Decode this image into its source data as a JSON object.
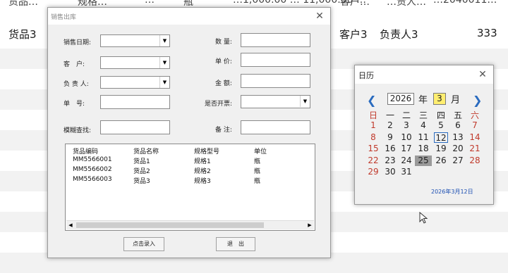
{
  "sheet": {
    "top_row_fragments": [
      "货品…",
      "规格…",
      "…",
      "瓶",
      "…1,000.00 … 11,000.00 …",
      "客户…",
      "…责人…",
      "…2040011…"
    ],
    "row": {
      "product": "货品3",
      "customer": "客户3",
      "owner": "负责人3",
      "number": "333"
    }
  },
  "sales_dialog": {
    "title": "销售出库",
    "close_glyph": "✕",
    "labels": {
      "sale_date": "销售日期:",
      "customer": "客　户:",
      "owner": "负 责 人:",
      "doc_no": "单　号:",
      "quantity": "数 量:",
      "unit_price": "单 价:",
      "amount": "金 额:",
      "invoiced": "是否开票:",
      "fuzzy_search": "模糊查找:",
      "remark": "备 注:"
    },
    "values": {
      "sale_date": "",
      "customer": "",
      "owner": "",
      "doc_no": "",
      "quantity": "",
      "unit_price": "",
      "amount": "",
      "invoiced": "",
      "fuzzy_search": "",
      "remark": ""
    },
    "list": {
      "columns": [
        "货品编码",
        "货品名称",
        "规格型号",
        "单位"
      ],
      "rows": [
        [
          "MM5566001",
          "货品1",
          "规格1",
          "瓶"
        ],
        [
          "MM5566002",
          "货品2",
          "规格2",
          "瓶"
        ],
        [
          "MM5566003",
          "货品3",
          "规格3",
          "瓶"
        ]
      ]
    },
    "buttons": {
      "enter": "点击录入",
      "exit": "退　出"
    }
  },
  "calendar": {
    "title": "日历",
    "close_glyph": "✕",
    "prev_glyph": "❮",
    "next_glyph": "❯",
    "year": "2026",
    "year_unit": "年",
    "month": "3",
    "month_unit": "月",
    "weekdays": [
      "日",
      "一",
      "二",
      "三",
      "四",
      "五",
      "六"
    ],
    "weeks": [
      [
        "1",
        "2",
        "3",
        "4",
        "5",
        "6",
        "7"
      ],
      [
        "8",
        "9",
        "10",
        "11",
        "12",
        "13",
        "14"
      ],
      [
        "15",
        "16",
        "17",
        "18",
        "19",
        "20",
        "21"
      ],
      [
        "22",
        "23",
        "24",
        "25",
        "26",
        "27",
        "28"
      ],
      [
        "29",
        "30",
        "31",
        "",
        "",
        "",
        ""
      ]
    ],
    "selected_day": "12",
    "highlighted_day": "25",
    "today_label": "2026年3月12日"
  },
  "colors": {
    "weekend": "#c0392b",
    "nav": "#2a6bbf",
    "month_highlight": "#ffee70",
    "link": "#1c4fb2"
  }
}
